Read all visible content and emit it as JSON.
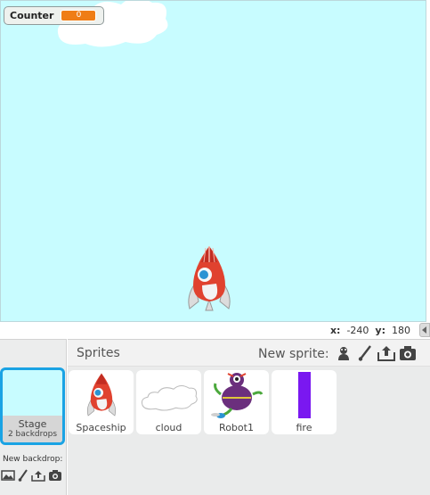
{
  "stage": {
    "monitor": {
      "label": "Counter",
      "value": "0"
    },
    "sprites_on_stage": [
      "Spaceship",
      "cloud"
    ]
  },
  "coords": {
    "x_label": "x:",
    "x_value": "-240",
    "y_label": "y:",
    "y_value": "180"
  },
  "stage_panel": {
    "name": "Stage",
    "backdrops": "2 backdrops",
    "new_backdrop_label": "New backdrop:",
    "tools": [
      "image-icon",
      "paintbrush-icon",
      "upload-icon",
      "camera-icon"
    ]
  },
  "sprites_panel": {
    "title": "Sprites",
    "new_sprite_label": "New sprite:",
    "tools": [
      "sprite-library-icon",
      "paintbrush-icon",
      "upload-icon",
      "camera-icon"
    ],
    "sprites": [
      {
        "name": "Spaceship",
        "icon": "spaceship-icon"
      },
      {
        "name": "cloud",
        "icon": "cloud-icon"
      },
      {
        "name": "Robot1",
        "icon": "robot-icon"
      },
      {
        "name": "fire",
        "icon": "fire-bar-icon"
      }
    ]
  },
  "colors": {
    "stage_bg": "#c8fcff",
    "monitor_value": "#ef7d16",
    "selected_border": "#1aa3e4",
    "fire": "#7a18f0",
    "spaceship_red": "#e0422f"
  }
}
